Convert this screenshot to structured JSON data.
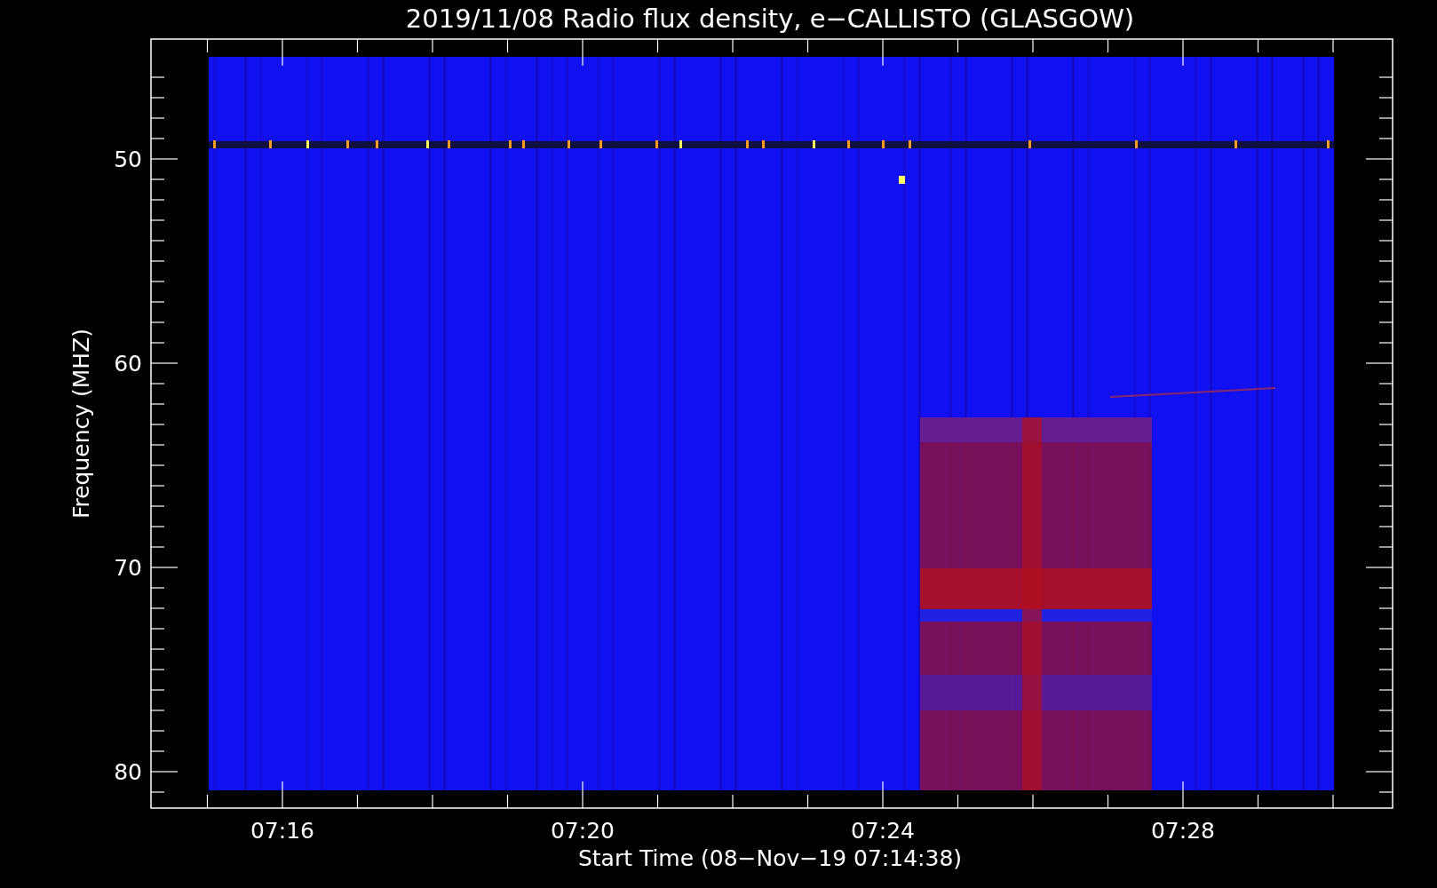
{
  "chart": {
    "title": "2019/11/08  Radio flux density, e−CALLISTO (GLASGOW)",
    "ylabel": "Frequency (MHZ)",
    "yticks": [
      "50",
      "60",
      "70",
      "80"
    ],
    "xticks": [
      "07:16",
      "07:20",
      "07:24",
      "07:28"
    ],
    "xlabel": "Start Time (08−Nov−19 07:14:38)"
  }
}
